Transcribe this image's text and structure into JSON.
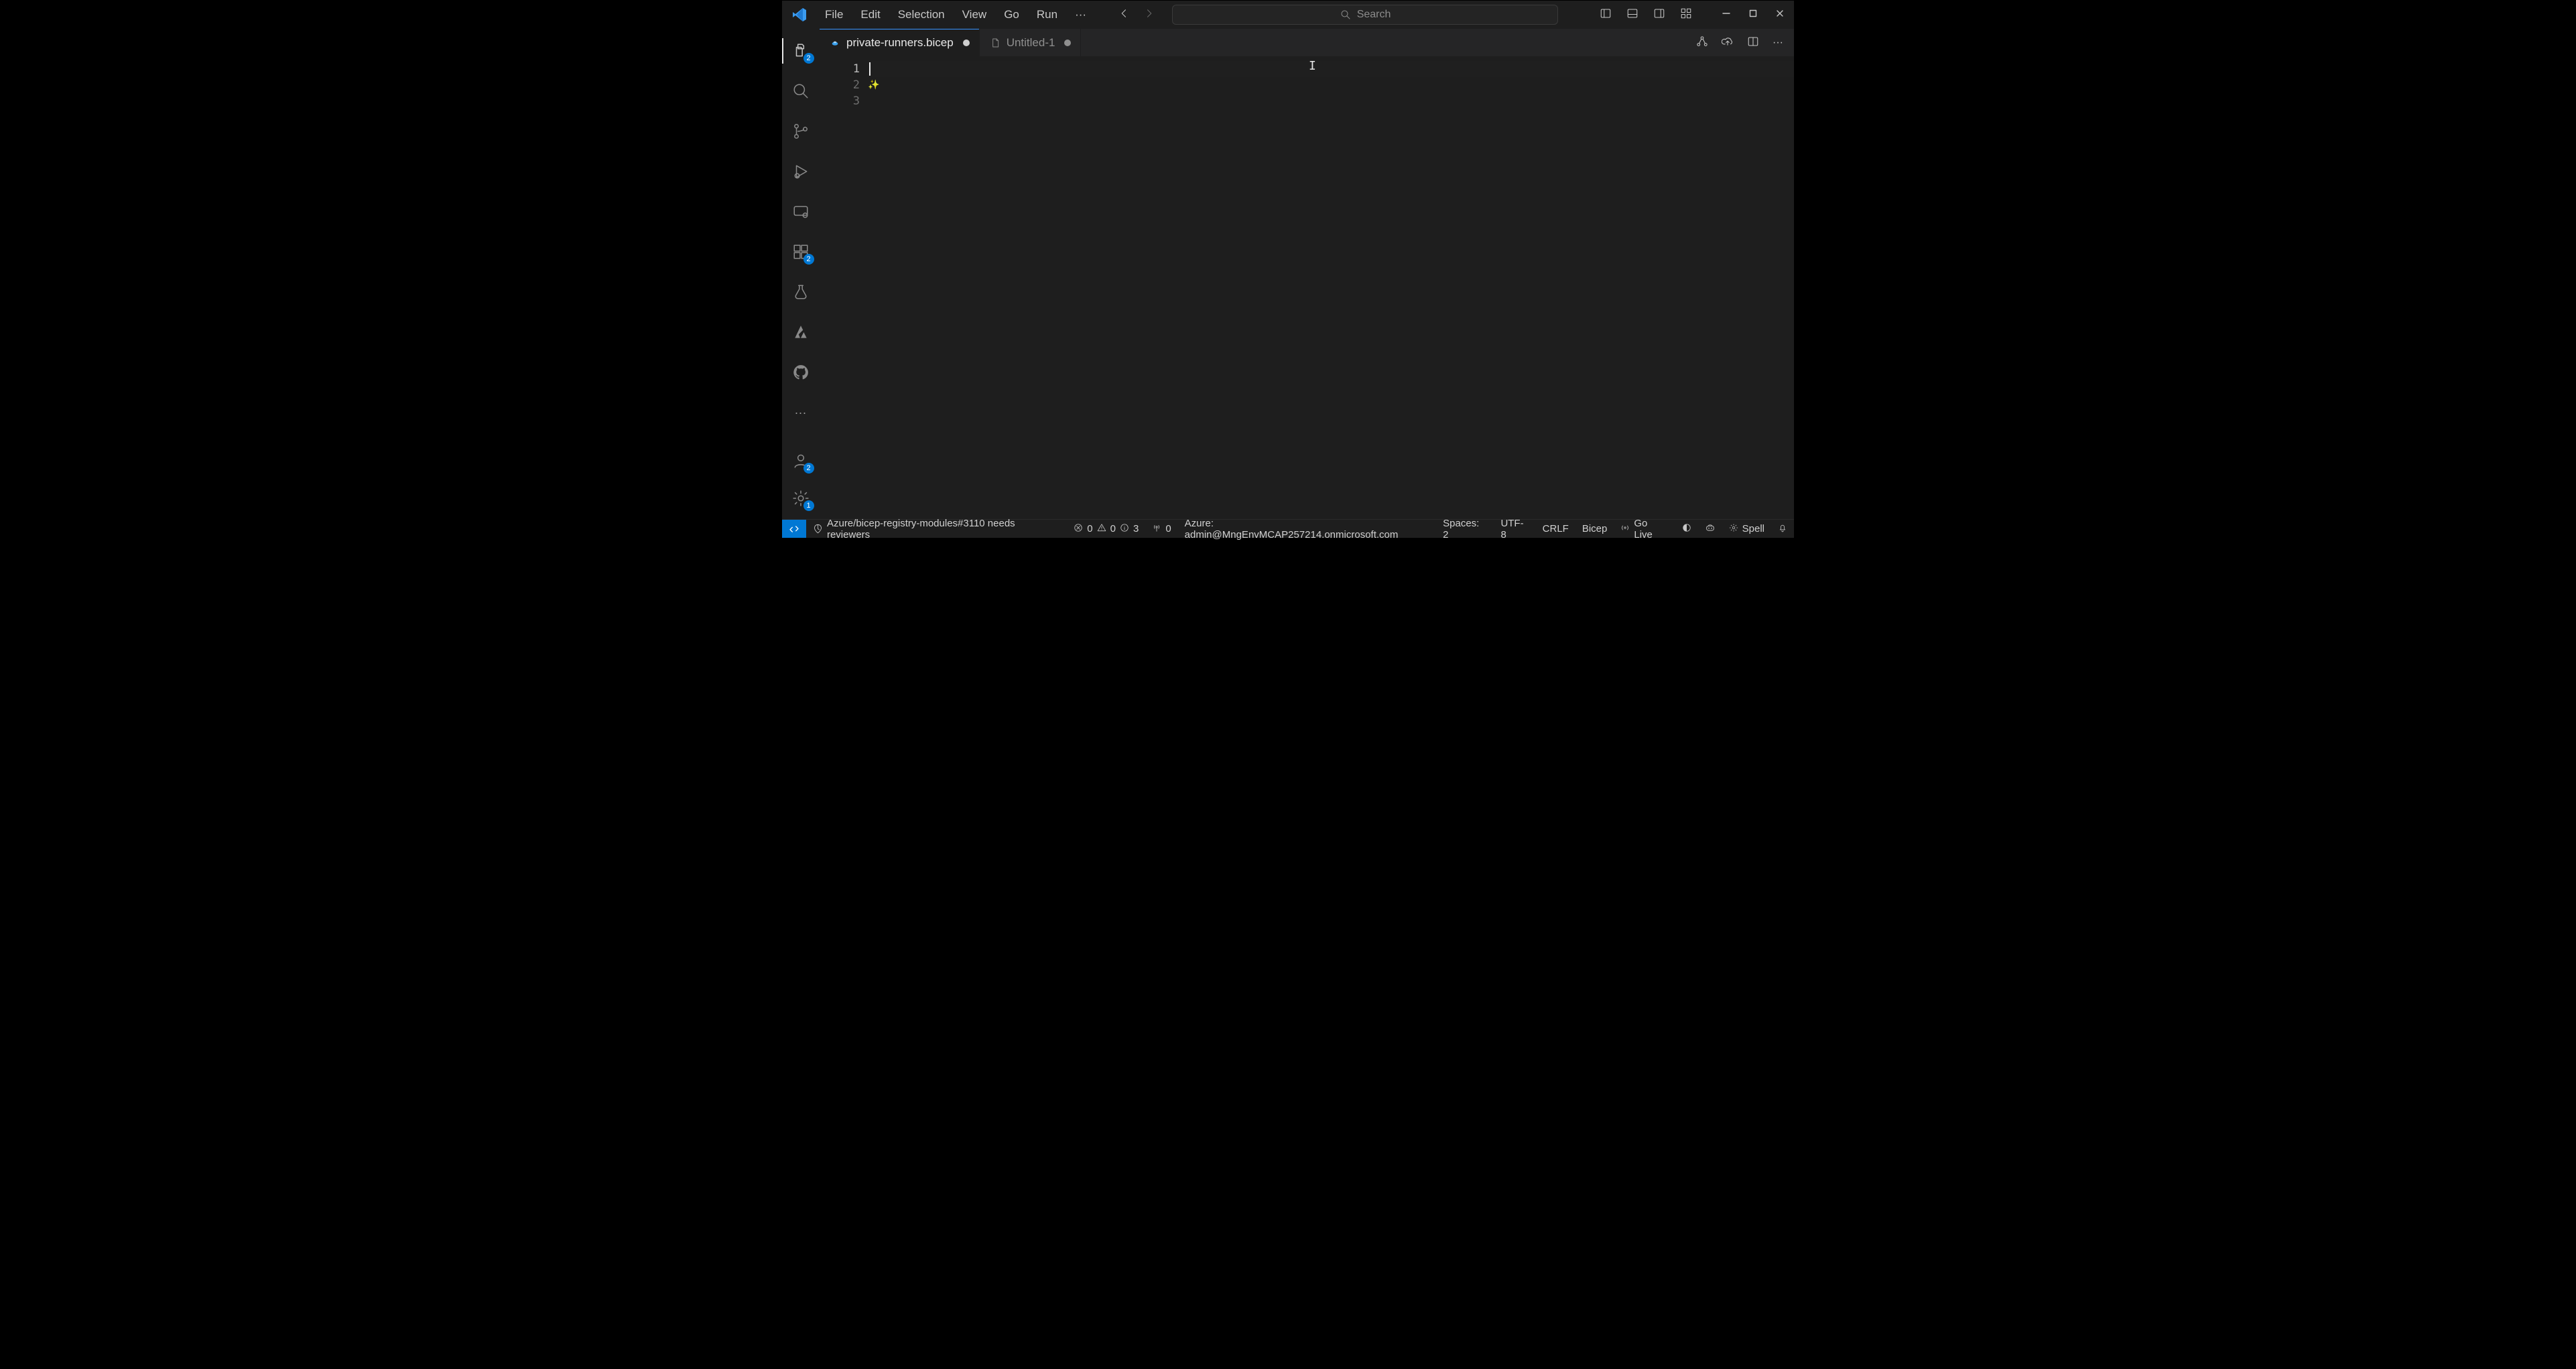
{
  "menu": {
    "file": "File",
    "edit": "Edit",
    "selection": "Selection",
    "view": "View",
    "go": "Go",
    "run": "Run"
  },
  "search": {
    "placeholder": "Search"
  },
  "activity": {
    "explorer_badge": "2",
    "extensions_badge": "2",
    "accounts_badge": "2",
    "settings_badge": "1"
  },
  "tabs": {
    "tab1": {
      "label": "private-runners.bicep",
      "dirty": true,
      "active": true,
      "icon": "bicep"
    },
    "tab2": {
      "label": "Untitled-1",
      "dirty": true,
      "active": false,
      "icon": "file"
    }
  },
  "editor": {
    "line_numbers": [
      "1",
      "2",
      "3"
    ]
  },
  "statusbar": {
    "gh_notification": "Azure/bicep-registry-modules#3110 needs reviewers",
    "errors": "0",
    "warnings": "0",
    "infos": "3",
    "ports": "0",
    "azure": "Azure: admin@MngEnvMCAP257214.onmicrosoft.com",
    "spaces": "Spaces: 2",
    "encoding": "UTF-8",
    "eol": "CRLF",
    "lang": "Bicep",
    "golive": "Go Live",
    "spell": "Spell"
  }
}
